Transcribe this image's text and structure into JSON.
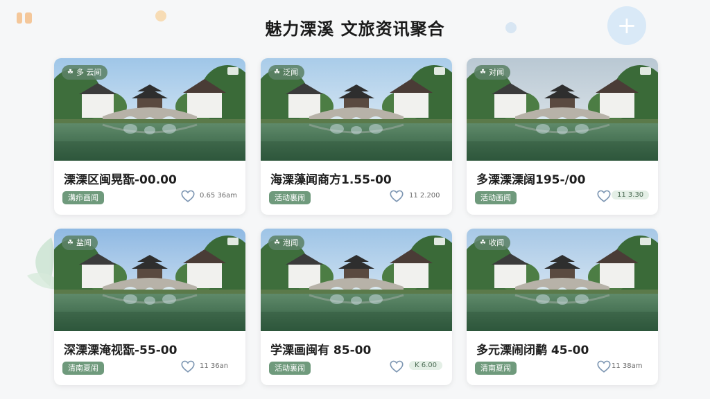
{
  "header": {
    "title": "魅力溧溪 文旅资讯聚合",
    "add_icon": "plus-icon"
  },
  "cards": [
    {
      "badge": "多 云间",
      "title": "溧溧区闽晃翫-00.00",
      "tag": "溝疖画闻",
      "meta": "0.65 36am",
      "meta_style": "plain"
    },
    {
      "badge": "泛闻",
      "title": "海溧藻闻商方1.55-00",
      "tag": "活动裏闹",
      "meta": "11 2.200",
      "meta_style": "plain"
    },
    {
      "badge": "对闻",
      "title": "多溧溧溧阔195-/00",
      "tag": "活动画闻",
      "meta": "11 3.30",
      "meta_style": "pill"
    },
    {
      "badge": "盐闻",
      "title": "深溧溧淹视翫-55-00",
      "tag": "清南夏闹",
      "meta": "11 36an",
      "meta_style": "plain"
    },
    {
      "badge": "泡闻",
      "title": "学溧画闽有 85-00",
      "tag": "活动裏闹",
      "meta": "K 6.00",
      "meta_style": "pill"
    },
    {
      "badge": "收闻",
      "title": "多元溧闹闭鹬 45-00",
      "tag": "清南夏闹",
      "meta": "11 38am",
      "meta_style": "plain"
    }
  ],
  "colors": {
    "accent_green": "#6f9a7c",
    "fab": "#d9e9f7"
  }
}
